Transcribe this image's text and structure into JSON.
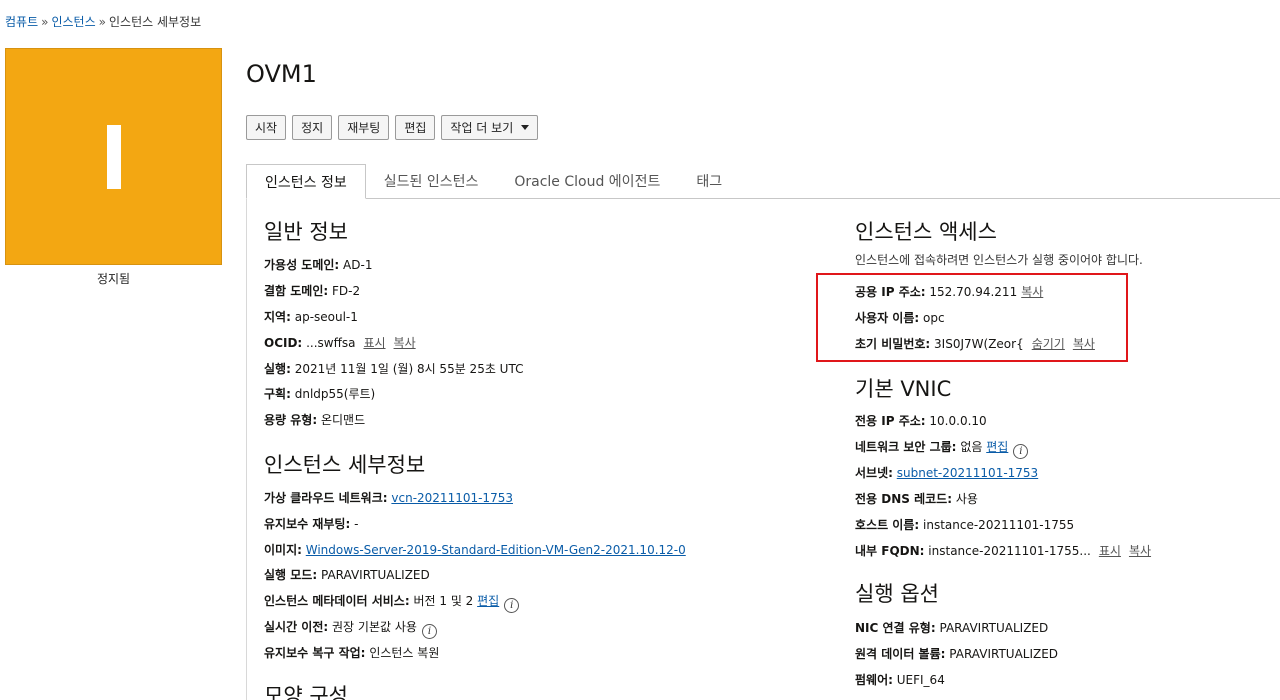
{
  "breadcrumb": {
    "item1": "컴퓨트",
    "item2": "인스턴스",
    "current": "인스턴스 세부정보",
    "sep": "»"
  },
  "badge": {
    "letter": "I",
    "status": "정지됨",
    "color": "#f3a712"
  },
  "title": "OVM1",
  "actions": {
    "start": "시작",
    "stop": "정지",
    "reboot": "재부팅",
    "edit": "편집",
    "more": "작업 더 보기"
  },
  "tabs": [
    "인스턴스 정보",
    "실드된 인스턴스",
    "Oracle Cloud 에이전트",
    "태그"
  ],
  "general": {
    "title": "일반 정보",
    "ad_label": "가용성 도메인:",
    "ad_value": "AD-1",
    "fd_label": "결함 도메인:",
    "fd_value": "FD-2",
    "region_label": "지역:",
    "region_value": "ap-seoul-1",
    "ocid_label": "OCID:",
    "ocid_value": "...swffsa",
    "ocid_show": "표시",
    "ocid_copy": "복사",
    "launched_label": "실행:",
    "launched_value": "2021년 11월 1일 (월) 8시 55분 25초 UTC",
    "compartment_label": "구획:",
    "compartment_value": "dnldp55(루트)",
    "capacity_label": "용량 유형:",
    "capacity_value": "온디맨드"
  },
  "details": {
    "title": "인스턴스 세부정보",
    "vcn_label": "가상 클라우드 네트워크:",
    "vcn_value": "vcn-20211101-1753",
    "maint_reboot_label": "유지보수 재부팅:",
    "maint_reboot_value": "-",
    "image_label": "이미지:",
    "image_value": "Windows-Server-2019-Standard-Edition-VM-Gen2-2021.10.12-0",
    "launch_mode_label": "실행 모드:",
    "launch_mode_value": "PARAVIRTUALIZED",
    "metadata_label": "인스턴스 메타데이터 서비스:",
    "metadata_value": "버전 1 및 2",
    "metadata_edit": "편집",
    "live_migration_label": "실시간 이전:",
    "live_migration_value": "권장 기본값 사용",
    "maint_recovery_label": "유지보수 복구 작업:",
    "maint_recovery_value": "인스턴스 복원"
  },
  "shape": {
    "title": "모양 구성"
  },
  "access": {
    "title": "인스턴스 액세스",
    "desc": "인스턴스에 접속하려면 인스턴스가 실행 중이어야 합니다.",
    "public_ip_label": "공용 IP 주소:",
    "public_ip_value": "152.70.94.211",
    "public_ip_copy": "복사",
    "username_label": "사용자 이름:",
    "username_value": "opc",
    "password_label": "초기 비밀번호:",
    "password_value": "3IS0J7W(Zeor{",
    "password_hide": "숨기기",
    "password_copy": "복사"
  },
  "vnic": {
    "title": "기본 VNIC",
    "private_ip_label": "전용 IP 주소:",
    "private_ip_value": "10.0.0.10",
    "nsg_label": "네트워크 보안 그룹:",
    "nsg_value": "없음",
    "nsg_edit": "편집",
    "subnet_label": "서브넷:",
    "subnet_value": "subnet-20211101-1753",
    "dns_label": "전용 DNS 레코드:",
    "dns_value": "사용",
    "hostname_label": "호스트 이름:",
    "hostname_value": "instance-20211101-1755",
    "fqdn_label": "내부 FQDN:",
    "fqdn_value": "instance-20211101-1755...",
    "fqdn_show": "표시",
    "fqdn_copy": "복사"
  },
  "launch_options": {
    "title": "실행 옵션",
    "nic_label": "NIC 연결 유형:",
    "nic_value": "PARAVIRTUALIZED",
    "remote_label": "원격 데이터 볼륨:",
    "remote_value": "PARAVIRTUALIZED",
    "firmware_label": "펌웨어:",
    "firmware_value": "UEFI_64"
  },
  "colors": {
    "accent": "#f3a712",
    "link": "#0a5ca8",
    "highlight": "#e0161a"
  }
}
